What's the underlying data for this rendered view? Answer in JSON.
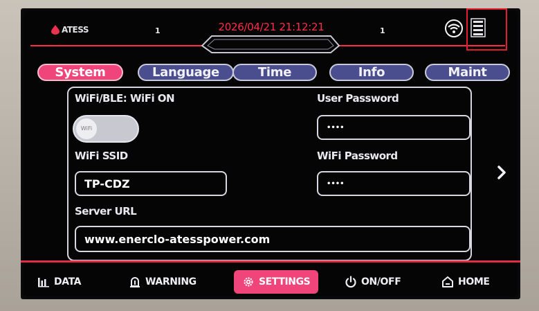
{
  "header": {
    "logo_text": "ATESS",
    "left_number": "1",
    "datetime": "2026/04/21 21:12:21",
    "right_number": "1",
    "icons": [
      "wifi-icon",
      "menu-list-icon"
    ]
  },
  "tabs": [
    {
      "label": "System",
      "active": true
    },
    {
      "label": "Language",
      "active": false
    },
    {
      "label": "Time",
      "active": false
    },
    {
      "label": "Info",
      "active": false
    },
    {
      "label": "Maint",
      "active": false
    }
  ],
  "system": {
    "wifi_ble_label": "WiFi/BLE: WiFi ON",
    "wifi_toggle_text": "WiFi",
    "wifi_ssid_label": "WiFi SSID",
    "wifi_ssid_value": "TP-CDZ",
    "user_password_label": "User Password",
    "user_password_value": "••••",
    "wifi_password_label": "WiFi Password",
    "wifi_password_value": "••••",
    "server_url_label": "Server URL",
    "server_url_value": "www.enerclo-atesspower.com"
  },
  "nav": {
    "data": "DATA",
    "warning": "WARNING",
    "settings": "SETTINGS",
    "onoff": "ON/OFF",
    "home": "HOME"
  },
  "colors": {
    "accent": "#f0457a",
    "datetime_red": "#ff2c47",
    "tab_inactive": "#4a4e8e",
    "background": "#050506"
  }
}
